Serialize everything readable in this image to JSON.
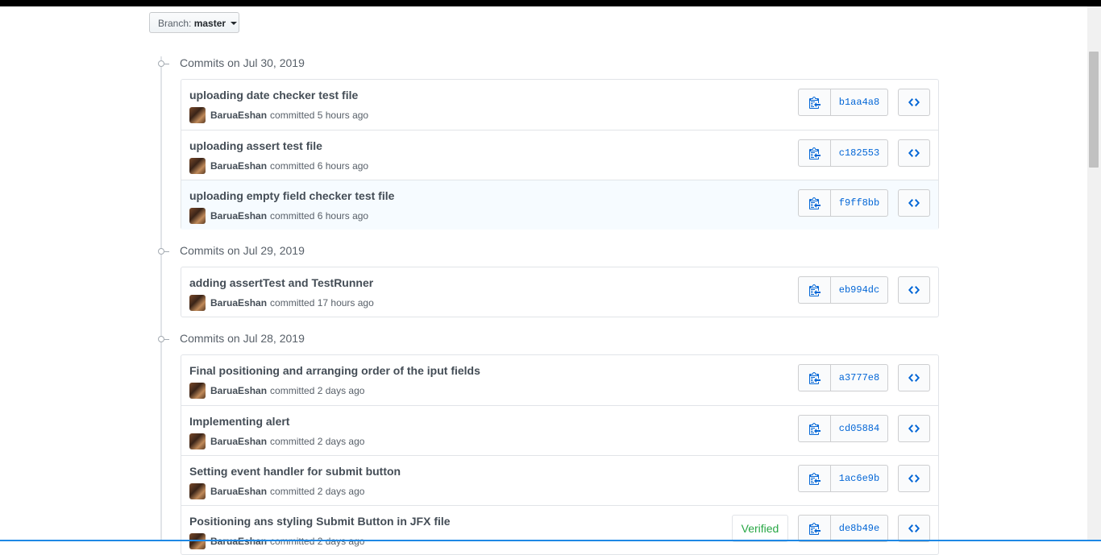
{
  "branch": {
    "prefix": "Branch:",
    "name": "master"
  },
  "groups": [
    {
      "title": "Commits on Jul 30, 2019",
      "commits": [
        {
          "message": "uploading date checker test file",
          "author": "BaruaEshan",
          "time": "committed 5 hours ago",
          "sha": "b1aa4a8"
        },
        {
          "message": "uploading assert test file",
          "author": "BaruaEshan",
          "time": "committed 6 hours ago",
          "sha": "c182553"
        },
        {
          "message": "uploading empty field checker test file",
          "author": "BaruaEshan",
          "time": "committed 6 hours ago",
          "sha": "f9ff8bb"
        }
      ]
    },
    {
      "title": "Commits on Jul 29, 2019",
      "commits": [
        {
          "message": "adding assertTest and TestRunner",
          "author": "BaruaEshan",
          "time": "committed 17 hours ago",
          "sha": "eb994dc"
        }
      ]
    },
    {
      "title": "Commits on Jul 28, 2019",
      "commits": [
        {
          "message": "Final positioning and arranging order of the iput fields",
          "author": "BaruaEshan",
          "time": "committed 2 days ago",
          "sha": "a3777e8"
        },
        {
          "message": "Implementing alert",
          "author": "BaruaEshan",
          "time": "committed 2 days ago",
          "sha": "cd05884"
        },
        {
          "message": "Setting event handler for submit button",
          "author": "BaruaEshan",
          "time": "committed 2 days ago",
          "sha": "1ac6e9b"
        },
        {
          "message": "Positioning ans styling Submit Button in JFX file",
          "author": "BaruaEshan",
          "time": "committed 2 days ago",
          "sha": "de8b49e",
          "badge": "Verified"
        }
      ]
    }
  ],
  "icons": {
    "copy": "clippy-icon",
    "browse": "code-icon",
    "avatar": "avatar"
  },
  "colors": {
    "link": "#0366d6",
    "verified": "#28a745",
    "muted": "#586069"
  }
}
